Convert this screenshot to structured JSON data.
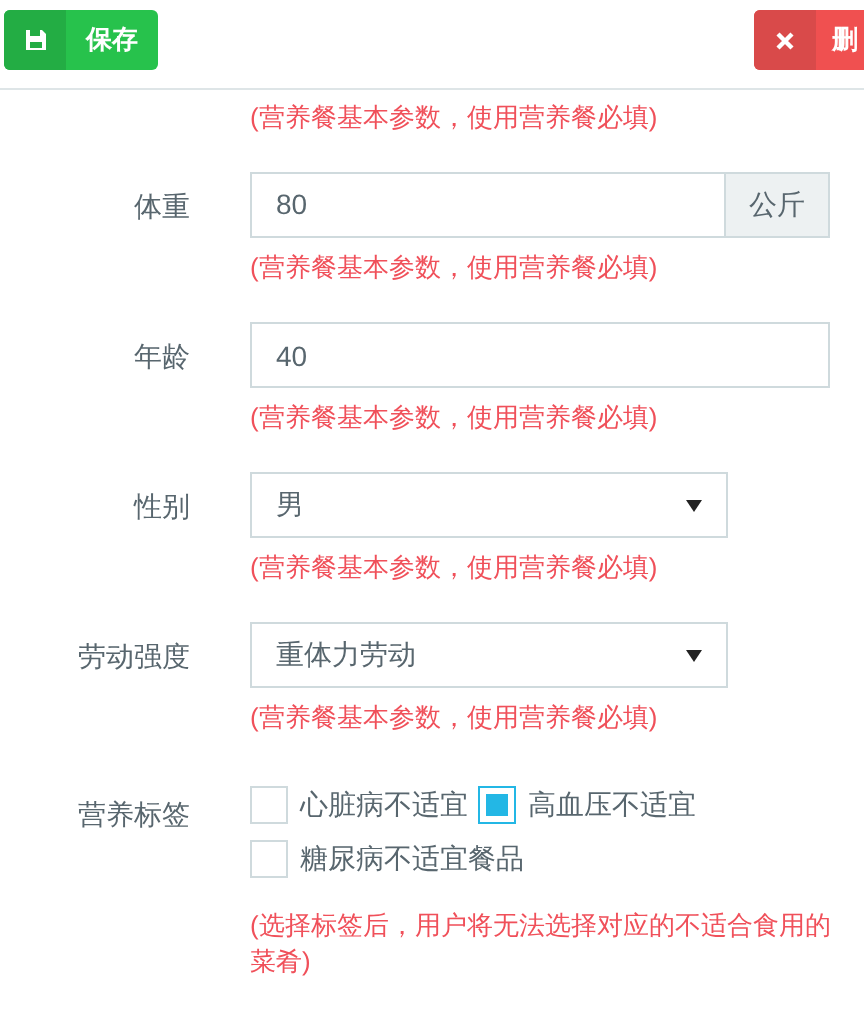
{
  "toolbar": {
    "save": {
      "label": "保存"
    },
    "delete": {
      "label": "删"
    }
  },
  "top_hint": "(营养餐基本参数，使用营养餐必填)",
  "fields": [
    {
      "kind": "addon",
      "label": "体重",
      "value": "80",
      "addon": "公斤",
      "hint": "(营养餐基本参数，使用营养餐必填)"
    },
    {
      "kind": "input",
      "label": "年龄",
      "value": "40",
      "hint": "(营养餐基本参数，使用营养餐必填)"
    },
    {
      "kind": "select",
      "label": "性别",
      "value": "男",
      "hint": "(营养餐基本参数，使用营养餐必填)"
    },
    {
      "kind": "select",
      "label": "劳动强度",
      "value": "重体力劳动",
      "hint": "(营养餐基本参数，使用营养餐必填)"
    },
    {
      "kind": "checkboxes",
      "label": "营养标签",
      "options": [
        {
          "label": "心脏病不适宜",
          "checked": false
        },
        {
          "label": "高血压不适宜",
          "checked": true
        },
        {
          "label": "糖尿病不适宜餐品",
          "checked": false
        }
      ],
      "hint": "(选择标签后，用户将无法选择对应的不适合食用的菜肴)"
    }
  ]
}
